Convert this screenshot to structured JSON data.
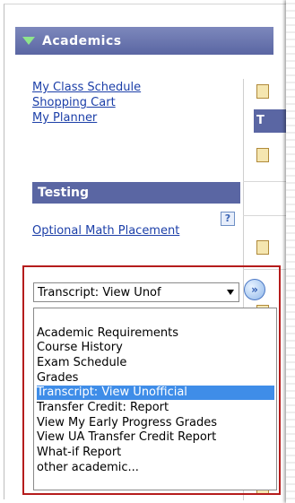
{
  "academics": {
    "title": "Academics",
    "links": [
      "My Class Schedule",
      "Shopping Cart",
      "My Planner"
    ]
  },
  "testing": {
    "title": "Testing",
    "link": "Optional Math Placement",
    "help": "?"
  },
  "side": {
    "header_text": "T"
  },
  "dropdown": {
    "selected_value": "Transcript: View Unof",
    "go_glyph": "»",
    "options": [
      "",
      "Academic Requirements",
      "Course History",
      "Exam Schedule",
      "Grades",
      "Transcript: View Unofficial",
      "Transfer Credit: Report",
      "View My Early Progress Grades",
      "View UA Transfer Credit Report",
      "What-if Report",
      "other academic..."
    ],
    "selected_index": 5
  },
  "colors": {
    "header_bg": "#5a66a3",
    "link": "#1c3fa8",
    "highlight": "#b51c1c",
    "selected_bg": "#3f8de8"
  }
}
